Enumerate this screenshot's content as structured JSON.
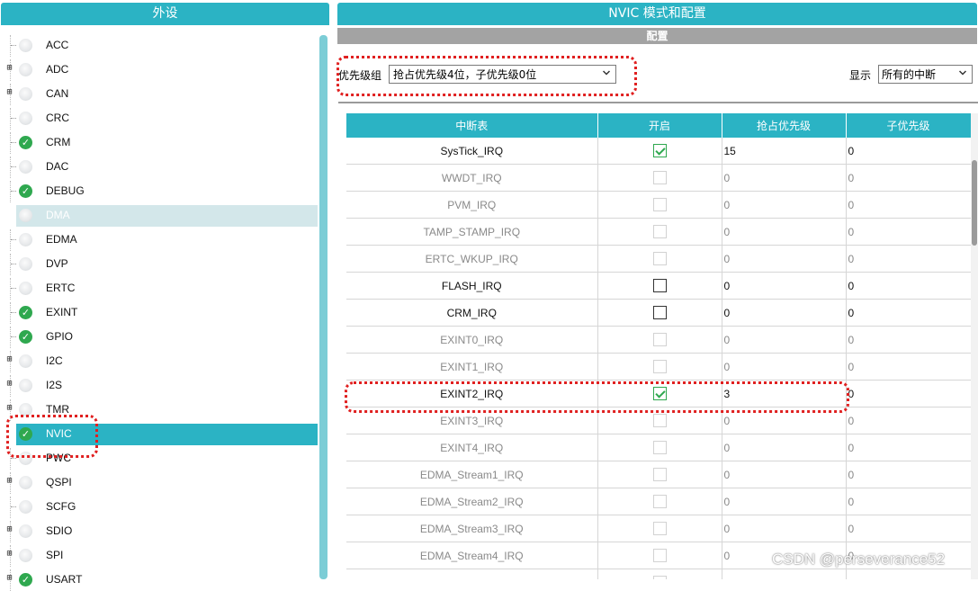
{
  "left_panel": {
    "title": "外设",
    "items": [
      {
        "label": "ACC",
        "expandable": false,
        "status": "off"
      },
      {
        "label": "ADC",
        "expandable": true,
        "status": "off"
      },
      {
        "label": "CAN",
        "expandable": true,
        "status": "off"
      },
      {
        "label": "CRC",
        "expandable": false,
        "status": "off"
      },
      {
        "label": "CRM",
        "expandable": false,
        "status": "on"
      },
      {
        "label": "DAC",
        "expandable": false,
        "status": "off"
      },
      {
        "label": "DEBUG",
        "expandable": false,
        "status": "on"
      },
      {
        "label": "DMA",
        "expandable": false,
        "status": "off",
        "state": "disabled"
      },
      {
        "label": "EDMA",
        "expandable": false,
        "status": "off"
      },
      {
        "label": "DVP",
        "expandable": false,
        "status": "off"
      },
      {
        "label": "ERTC",
        "expandable": false,
        "status": "off"
      },
      {
        "label": "EXINT",
        "expandable": false,
        "status": "on"
      },
      {
        "label": "GPIO",
        "expandable": false,
        "status": "on"
      },
      {
        "label": "I2C",
        "expandable": true,
        "status": "off"
      },
      {
        "label": "I2S",
        "expandable": true,
        "status": "off"
      },
      {
        "label": "TMR",
        "expandable": true,
        "status": "off"
      },
      {
        "label": "NVIC",
        "expandable": false,
        "status": "on",
        "state": "selected"
      },
      {
        "label": "PWC",
        "expandable": false,
        "status": "off"
      },
      {
        "label": "QSPI",
        "expandable": true,
        "status": "off"
      },
      {
        "label": "SCFG",
        "expandable": false,
        "status": "off"
      },
      {
        "label": "SDIO",
        "expandable": true,
        "status": "off"
      },
      {
        "label": "SPI",
        "expandable": true,
        "status": "off"
      },
      {
        "label": "USART",
        "expandable": true,
        "status": "on"
      }
    ]
  },
  "right_panel": {
    "title": "NVIC 模式和配置",
    "config_label": "配置",
    "priority_group_label": "优先级组",
    "priority_group_value": "抢占优先级4位，子优先级0位",
    "show_label": "显示",
    "show_value": "所有的中断",
    "table": {
      "headers": [
        "中断表",
        "开启",
        "抢占优先级",
        "子优先级"
      ],
      "rows": [
        {
          "name": "SysTick_IRQ",
          "enabled": "checked",
          "preempt": "15",
          "sub": "0",
          "active": true
        },
        {
          "name": "WWDT_IRQ",
          "enabled": "disabled",
          "preempt": "0",
          "sub": "0",
          "active": false
        },
        {
          "name": "PVM_IRQ",
          "enabled": "disabled",
          "preempt": "0",
          "sub": "0",
          "active": false
        },
        {
          "name": "TAMP_STAMP_IRQ",
          "enabled": "disabled",
          "preempt": "0",
          "sub": "0",
          "active": false
        },
        {
          "name": "ERTC_WKUP_IRQ",
          "enabled": "disabled",
          "preempt": "0",
          "sub": "0",
          "active": false
        },
        {
          "name": "FLASH_IRQ",
          "enabled": "unchecked",
          "preempt": "0",
          "sub": "0",
          "active": true
        },
        {
          "name": "CRM_IRQ",
          "enabled": "unchecked",
          "preempt": "0",
          "sub": "0",
          "active": true
        },
        {
          "name": "EXINT0_IRQ",
          "enabled": "disabled",
          "preempt": "0",
          "sub": "0",
          "active": false
        },
        {
          "name": "EXINT1_IRQ",
          "enabled": "disabled",
          "preempt": "0",
          "sub": "0",
          "active": false
        },
        {
          "name": "EXINT2_IRQ",
          "enabled": "checked",
          "preempt": "3",
          "sub": "0",
          "active": true
        },
        {
          "name": "EXINT3_IRQ",
          "enabled": "disabled",
          "preempt": "0",
          "sub": "0",
          "active": false
        },
        {
          "name": "EXINT4_IRQ",
          "enabled": "disabled",
          "preempt": "0",
          "sub": "0",
          "active": false
        },
        {
          "name": "EDMA_Stream1_IRQ",
          "enabled": "disabled",
          "preempt": "0",
          "sub": "0",
          "active": false
        },
        {
          "name": "EDMA_Stream2_IRQ",
          "enabled": "disabled",
          "preempt": "0",
          "sub": "0",
          "active": false
        },
        {
          "name": "EDMA_Stream3_IRQ",
          "enabled": "disabled",
          "preempt": "0",
          "sub": "0",
          "active": false
        },
        {
          "name": "EDMA_Stream4_IRQ",
          "enabled": "disabled",
          "preempt": "0",
          "sub": "0",
          "active": false
        },
        {
          "name": "",
          "enabled": "disabled",
          "preempt": "",
          "sub": "",
          "active": false
        }
      ]
    }
  },
  "watermark": "CSDN @perseverance52",
  "colors": {
    "accent": "#2bb3c4",
    "check": "#2fa84f",
    "highlight": "#e02020",
    "config_bar": "#a3a3a3"
  }
}
